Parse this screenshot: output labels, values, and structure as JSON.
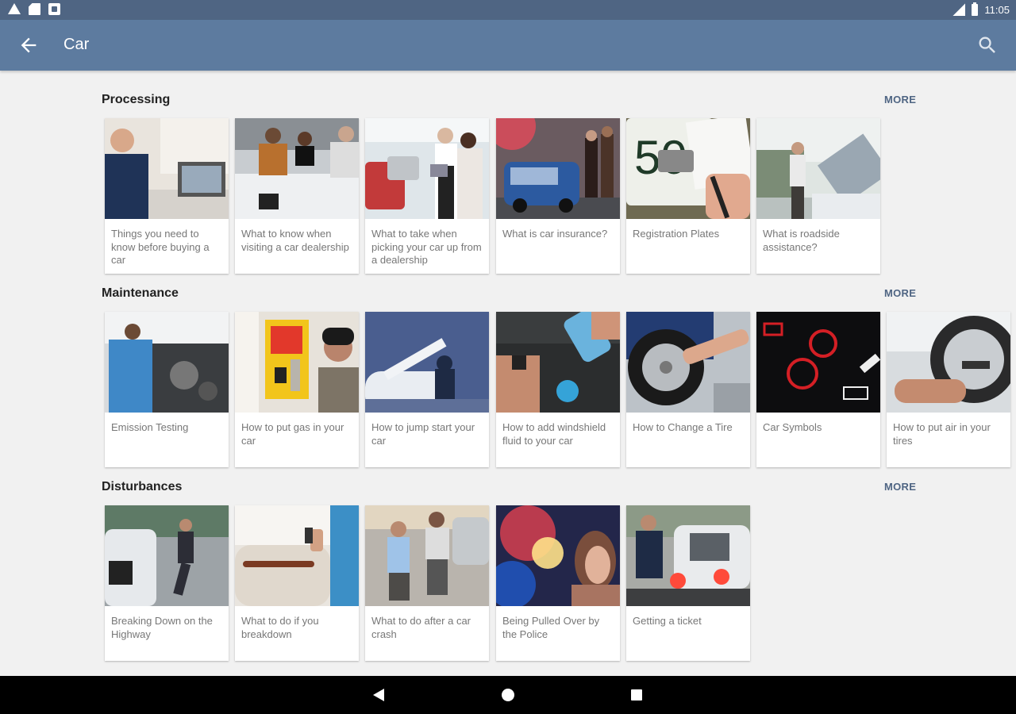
{
  "status_bar": {
    "time": "11:05",
    "icons": [
      "warning-icon",
      "sd-card-icon",
      "notification-icon",
      "signal-icon",
      "battery-icon"
    ]
  },
  "app_bar": {
    "title": "Car",
    "back_icon": "arrow-left-icon",
    "search_icon": "search-icon",
    "color": "#5d7b9f"
  },
  "sections": [
    {
      "title": "Processing",
      "more": "MORE",
      "cards": [
        {
          "label": "Things you need to know before buying a car"
        },
        {
          "label": "What to know when visiting a car dealership"
        },
        {
          "label": "What to take when picking your car up from a dealership"
        },
        {
          "label": "What is car insurance?"
        },
        {
          "label": "Registration Plates"
        },
        {
          "label": "What is roadside assistance?"
        }
      ]
    },
    {
      "title": "Maintenance",
      "more": "MORE",
      "cards": [
        {
          "label": "Emission Testing"
        },
        {
          "label": "How to put gas in your car"
        },
        {
          "label": "How to jump start your car"
        },
        {
          "label": "How to add windshield fluid to your car"
        },
        {
          "label": "How to Change a Tire"
        },
        {
          "label": "Car Symbols"
        },
        {
          "label": "How to put air in your tires"
        }
      ]
    },
    {
      "title": "Disturbances",
      "more": "MORE",
      "cards": [
        {
          "label": "Breaking Down on the Highway"
        },
        {
          "label": "What to do if you breakdown"
        },
        {
          "label": "What to do after a car crash"
        },
        {
          "label": "Being Pulled Over by the Police"
        },
        {
          "label": "Getting a ticket"
        }
      ]
    }
  ],
  "nav_bar": {
    "icons": [
      "nav-back-icon",
      "nav-home-icon",
      "nav-recents-icon"
    ]
  },
  "colors": {
    "accent": "#4f6583",
    "status_bar": "#4f6583",
    "background": "#f1f1f1"
  }
}
